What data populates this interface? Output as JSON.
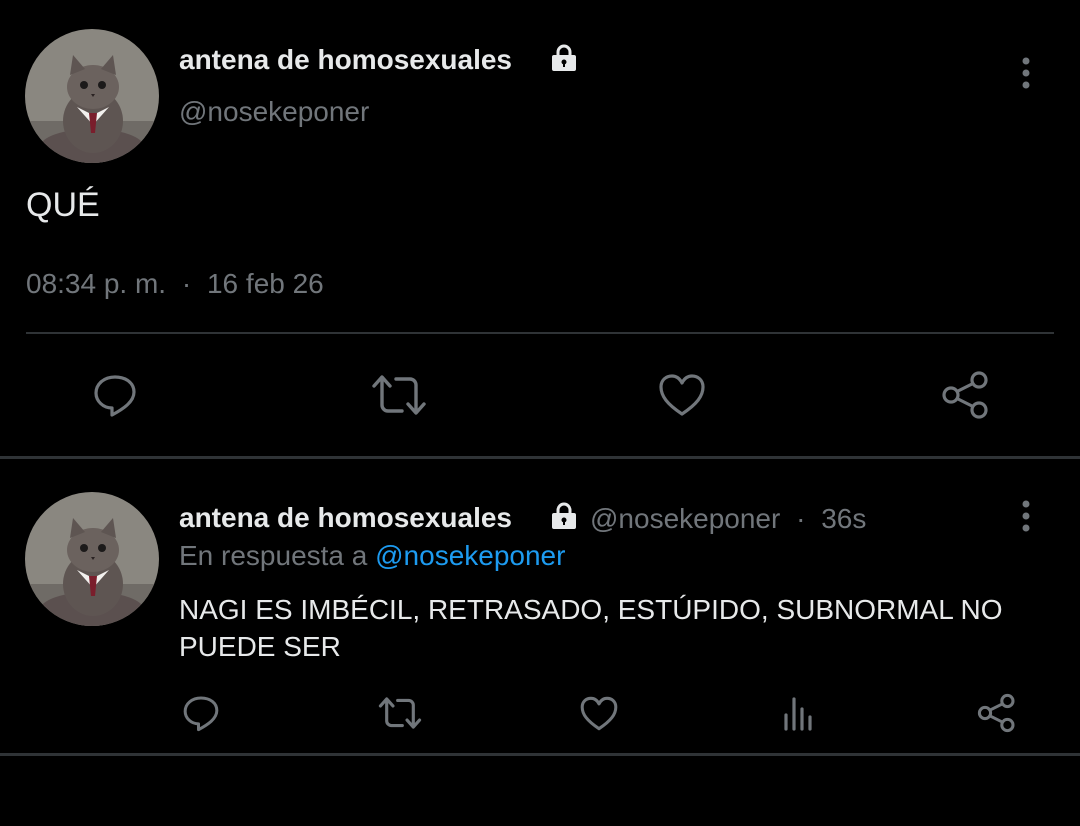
{
  "main_tweet": {
    "display_name": "antena de homosexuales",
    "handle": "@nosekeponer",
    "text": "QUÉ",
    "time": "08:34 p. m.",
    "separator": "·",
    "date": "16 feb 26"
  },
  "reply": {
    "display_name": "antena de homosexuales",
    "handle": "@nosekeponer",
    "separator": "·",
    "age": "36s",
    "in_reply_prefix": "En respuesta a",
    "in_reply_mention": "@nosekeponer",
    "text": "NAGI ES IMBÉCIL, RETRASADO, ESTÚPIDO, SUBNORMAL NO PUEDE SER"
  },
  "icons": {
    "avatar": "cat-avatar",
    "lock": "lock-icon",
    "more": "more-vertical-icon",
    "reply": "comment-icon",
    "retweet": "retweet-icon",
    "like": "heart-icon",
    "views": "bar-chart-icon",
    "share": "share-icon"
  },
  "colors": {
    "background": "#000000",
    "text_primary": "#e7e9ea",
    "text_secondary": "#71767b",
    "accent": "#1d9bf0",
    "divider": "#2f3336"
  }
}
